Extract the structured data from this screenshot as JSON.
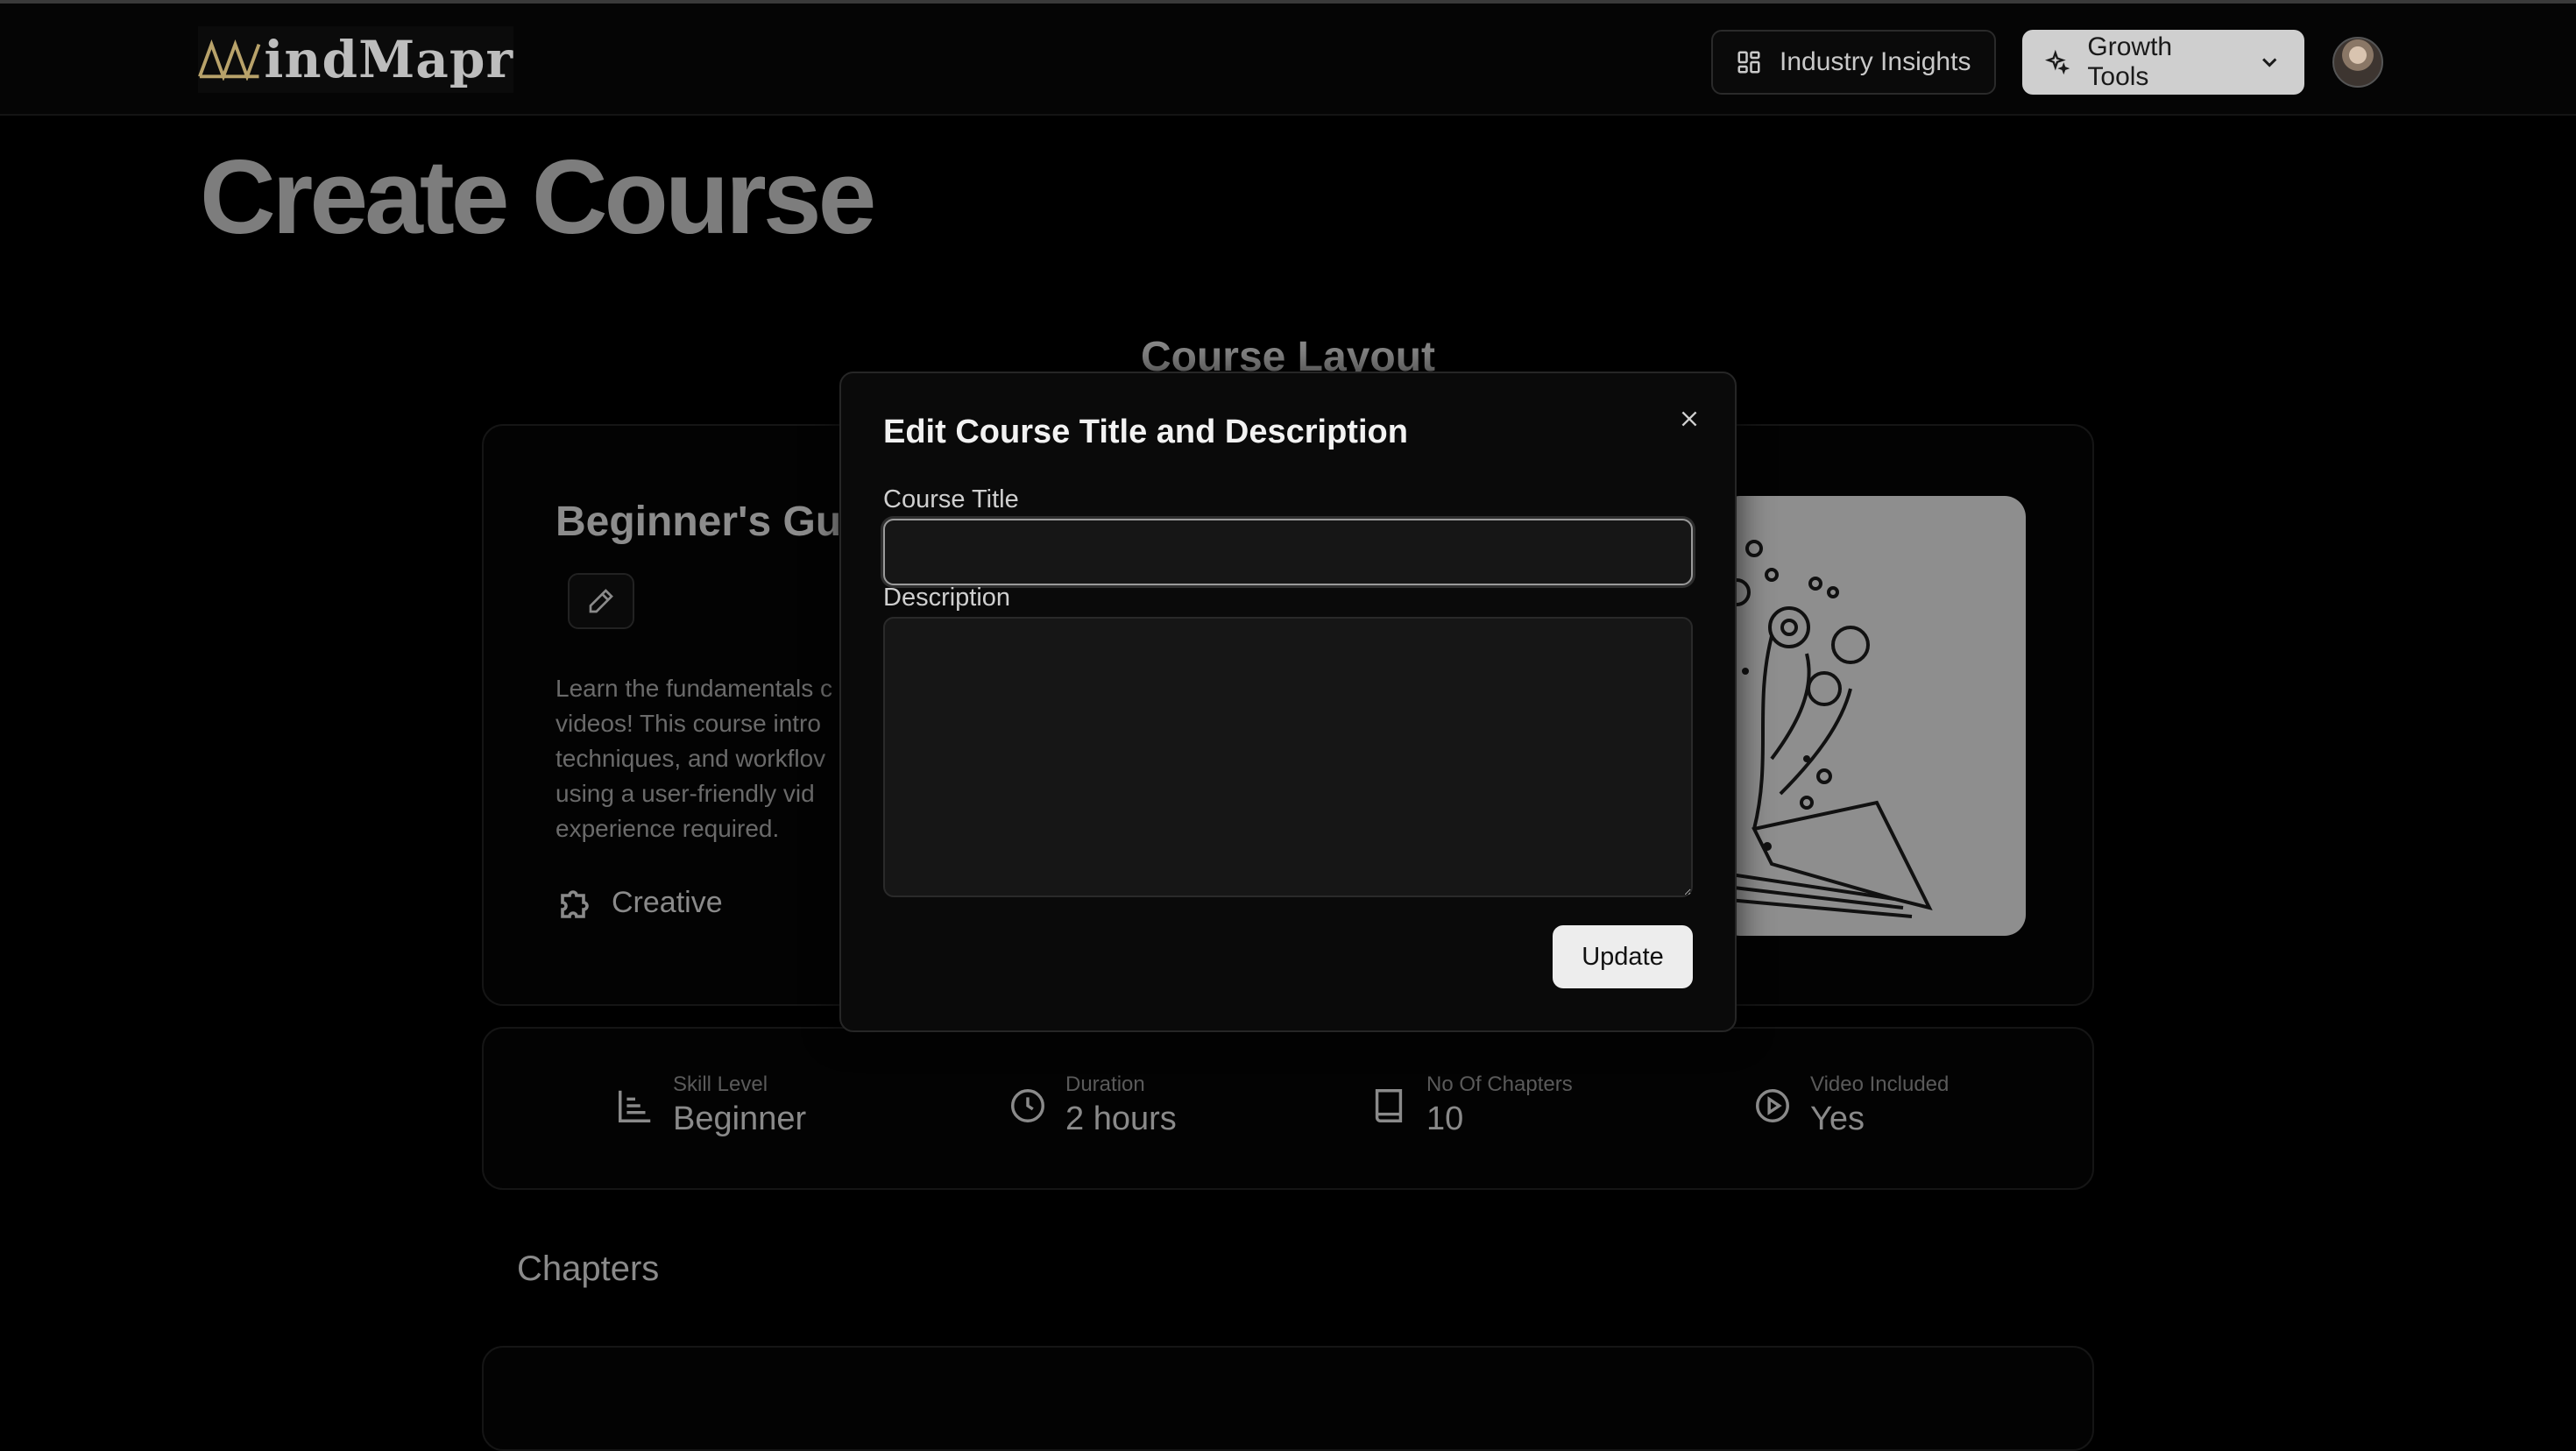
{
  "header": {
    "logo_text": "indMapr",
    "insights_label": "Industry Insights",
    "growth_label": "Growth Tools"
  },
  "page": {
    "title": "Create Course",
    "section_title": "Course Layout"
  },
  "course": {
    "name": "Beginner's Gu",
    "description": "Learn the fundamentals c videos! This course intro techniques, and workflov using a user-friendly vid experience required.",
    "category": "Creative"
  },
  "stats": [
    {
      "label": "Skill Level",
      "value": "Beginner",
      "icon": "bar-chart-icon"
    },
    {
      "label": "Duration",
      "value": "2 hours",
      "icon": "clock-icon"
    },
    {
      "label": "No Of Chapters",
      "value": "10",
      "icon": "book-icon"
    },
    {
      "label": "Video Included",
      "value": "Yes",
      "icon": "play-circle-icon"
    }
  ],
  "chapters": {
    "title": "Chapters"
  },
  "modal": {
    "title": "Edit Course Title and Description",
    "course_title_label": "Course Title",
    "course_title_value": "",
    "description_label": "Description",
    "description_value": "",
    "update_label": "Update"
  },
  "colors": {
    "background": "#000000",
    "modal_bg": "#0a0a0a",
    "primary_button": "#ededed"
  }
}
